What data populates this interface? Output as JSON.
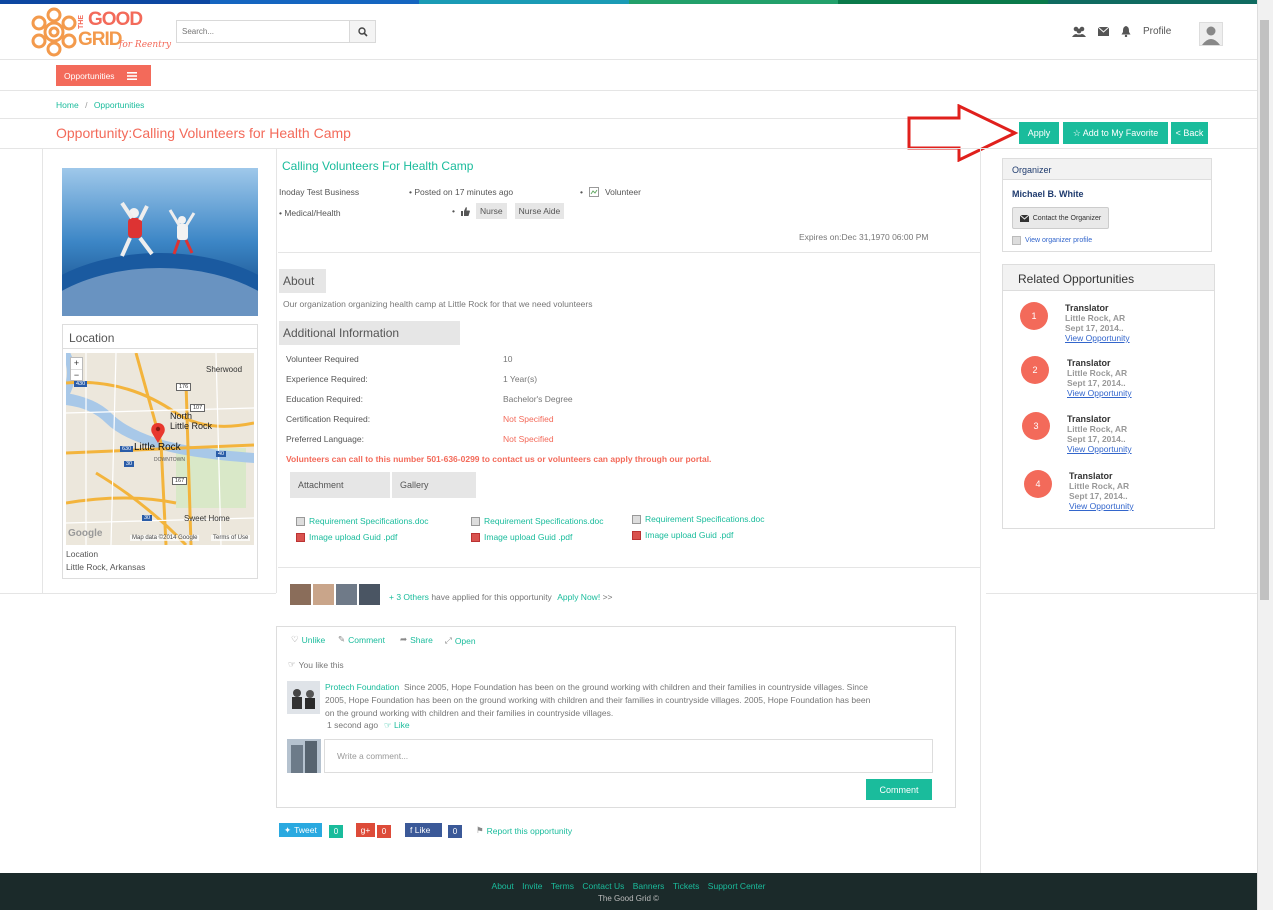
{
  "header": {
    "brand_line1": "THE",
    "brand_line2": "GOOD",
    "brand_line3": "GRID",
    "brand_tag": "for Reentry",
    "search_placeholder": "Search...",
    "profile_label": "Profile",
    "stripe_colors": [
      "#0d47a1",
      "#1565c0",
      "#1a9bb5",
      "#22a06b",
      "#0a7a4a",
      "#0f6b60"
    ]
  },
  "nav": {
    "opportunities_label": "Opportunities"
  },
  "breadcrumb": {
    "home": "Home",
    "sep": "/",
    "current": "Opportunities"
  },
  "page": {
    "title": "Opportunity:Calling Volunteers for Health Camp",
    "apply": "Apply",
    "favorite": "☆ Add to My Favorite",
    "back": "< Back"
  },
  "location": {
    "heading": "Location",
    "label": "Location",
    "value": "Little Rock, Arkansas",
    "map_city": "Little Rock",
    "map_north": "North\nLittle Rock",
    "map_sherwood": "Sherwood",
    "map_sweet_home": "Sweet Home",
    "map_downtown": "DOWNTOWN",
    "map_data": "Map data ©2014 Google",
    "map_terms": "Terms of Use",
    "map_google": "Google",
    "zoom_in": "+",
    "zoom_out": "−",
    "shields": [
      "430",
      "176",
      "107",
      "630",
      "30",
      "167",
      "30",
      "40"
    ]
  },
  "opportunity": {
    "heading": "Calling Volunteers For Health Camp",
    "business": "Inoday Test Business",
    "posted": "Posted on 17 minutes ago",
    "type": "Volunteer",
    "category": "Medical/Health",
    "tags": [
      "Nurse",
      "Nurse Aide"
    ],
    "expires": "Expires on:Dec 31,1970 06:00 PM",
    "about_heading": "About",
    "about_text": "Our organization organizing health camp at Little Rock for that we need volunteers",
    "additional_heading": "Additional Information",
    "info": [
      {
        "label": "Volunteer Required",
        "value": "10"
      },
      {
        "label": "Experience Required:",
        "value": "1  Year(s)"
      },
      {
        "label": "Education Required:",
        "value": "Bachelor's Degree"
      },
      {
        "label": "Certification Required:",
        "value": "Not Specified"
      },
      {
        "label": "Preferred Language:",
        "value": "Not Specified"
      }
    ],
    "contact_note": "Volunteers can call to this number 501-636-0299 to contact us or volunteers can apply through our portal.",
    "tab_attachment": "Attachment",
    "tab_gallery": "Gallery",
    "files": [
      {
        "doc": "Requirement Specifications.doc",
        "pdf": "Image upload Guid .pdf"
      },
      {
        "doc": "Requirement Specifications.doc",
        "pdf": "Image upload Guid .pdf"
      },
      {
        "doc": "Requirement Specifications.doc",
        "pdf": "Image upload Guid .pdf"
      }
    ]
  },
  "applicants": {
    "others": "+ 3 Others",
    "text": "have applied for this opportunity",
    "apply_now": "Apply Now!",
    "suffix": ">>"
  },
  "social": {
    "unlike": "Unlike",
    "comment": "Comment",
    "share": "Share",
    "open": "Open",
    "you_like": "You like this",
    "commenter": "Protech Foundation",
    "comment_l1": "Since 2005, Hope Foundation has been on the ground working with children and their families in countryside villages. Since",
    "comment_l2": "2005, Hope Foundation has been on the ground working with children and their families in countryside villages. 2005, Hope Foundation has been",
    "comment_l3": "on the ground working with children and their families in countryside villages.",
    "time": "1 second ago",
    "like": "Like",
    "placeholder": "Write a comment...",
    "button": "Comment",
    "tweet": "Tweet",
    "tweet_count": "0",
    "gplus": "g+",
    "gplus_count": "0",
    "fb_like": "f  Like",
    "fb_count": "0",
    "report": "Report this opportunity"
  },
  "organizer": {
    "heading": "Organizer",
    "name": "Michael B. White",
    "contact": "Contact the Organizer",
    "view_profile": "View organizer profile"
  },
  "related": {
    "heading": "Related Opportunities",
    "items": [
      {
        "num": "1",
        "title": "Translator",
        "place": "Little Rock, AR",
        "date": "Sept 17, 2014..",
        "link": "View Opportunity"
      },
      {
        "num": "2",
        "title": "Translator",
        "place": "Little Rock, AR",
        "date": "Sept 17, 2014..",
        "link": "View Opportunity"
      },
      {
        "num": "3",
        "title": "Translator",
        "place": "Little Rock, AR",
        "date": "Sept 17, 2014..",
        "link": "View Opportunity"
      },
      {
        "num": "4",
        "title": "Translator",
        "place": "Little Rock, AR",
        "date": "Sept 17, 2014..",
        "link": "View Opportunity"
      }
    ]
  },
  "footer": {
    "links": [
      "About",
      "Invite",
      "Terms",
      "Contact Us",
      "Banners",
      "Tickets",
      "Support Center"
    ],
    "copyright": "The Good Grid ©"
  }
}
